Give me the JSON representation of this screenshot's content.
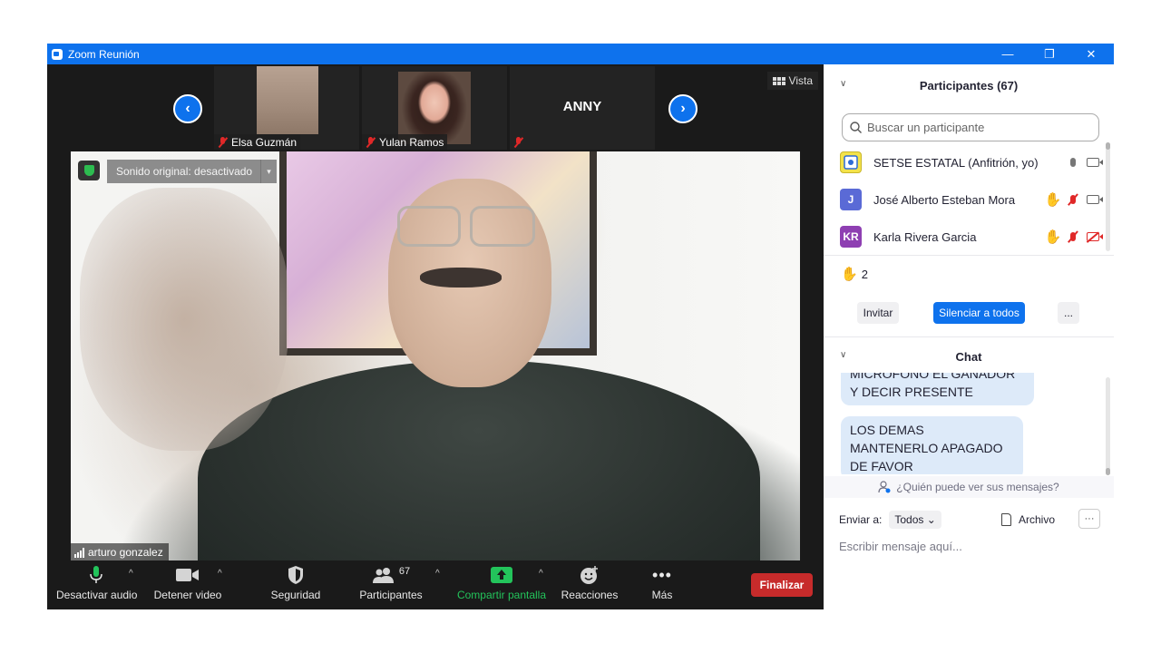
{
  "window": {
    "title": "Zoom Reunión",
    "minimize": "—",
    "restore": "❐",
    "close": "✕"
  },
  "strip": {
    "tiles": [
      {
        "name": "Elsa Guzmán"
      },
      {
        "name": "Yulan Ramos"
      },
      {
        "name": "ANNY"
      }
    ],
    "prev": "‹",
    "next": "›",
    "view_label": "Vista"
  },
  "main_video": {
    "original_sound": "Sonido original: desactivado",
    "speaker": "arturo gonzalez"
  },
  "toolbar": {
    "audio": "Desactivar audio",
    "video": "Detener video",
    "security": "Seguridad",
    "participants": "Participantes",
    "participants_count": "67",
    "share": "Compartir pantalla",
    "reactions": "Reacciones",
    "more": "Más",
    "end": "Finalizar"
  },
  "participants_panel": {
    "title": "Participantes (67)",
    "search_placeholder": "Buscar un participante",
    "participants": [
      {
        "name": "SETSE ESTATAL (Anfitrión, yo)",
        "avatar": "",
        "avatar_color": "#f3e24a"
      },
      {
        "name": "José Alberto Esteban Mora",
        "avatar": "J",
        "avatar_color": "#5a6ad6"
      },
      {
        "name": "Karla Rivera Garcia",
        "avatar": "KR",
        "avatar_color": "#8e3fb2"
      }
    ],
    "hands_count": "2",
    "invite": "Invitar",
    "mute_all": "Silenciar a todos",
    "more": "..."
  },
  "chat_panel": {
    "title": "Chat",
    "messages": [
      "MICROFONO EL GANADOR Y DECIR PRESENTE",
      "LOS DEMAS MANTENERLO APAGADO DE FAVOR"
    ],
    "who_sees": "¿Quién puede ver sus mensajes?",
    "send_to_label": "Enviar a:",
    "send_to_value": "Todos",
    "file": "Archivo",
    "more": "···",
    "input_placeholder": "Escribir mensaje aquí..."
  },
  "colors": {
    "zoom_blue": "#0e72ed",
    "end_red": "#c72b2b",
    "share_green": "#23c45b",
    "hand_yellow": "#f5b400",
    "bubble": "#ddeaf9"
  }
}
